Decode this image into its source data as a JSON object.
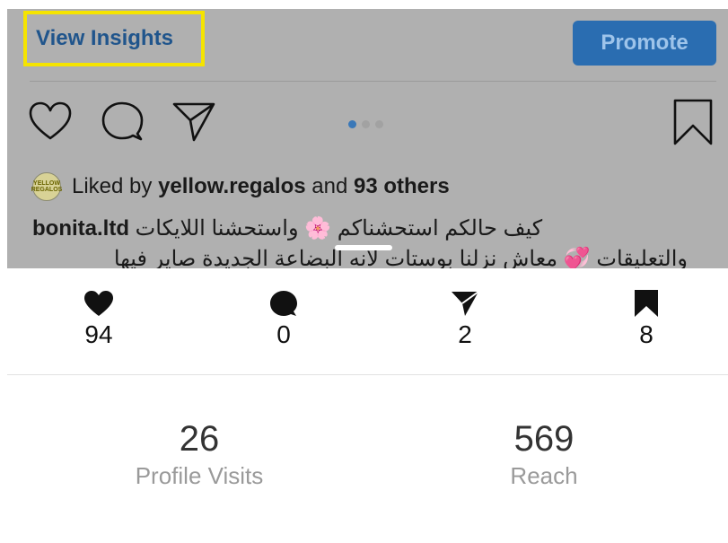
{
  "header": {
    "view_insights_label": "View Insights",
    "promote_label": "Promote"
  },
  "post": {
    "carousel": {
      "dot_count": 3,
      "active_index": 0
    },
    "likes": {
      "prefix": "Liked by",
      "liker": "yellow.regalos",
      "connector": "and",
      "others": "93 others",
      "avatar_text": "YELLOW REGALOS"
    },
    "caption": {
      "username": "bonita.ltd",
      "line1_text": "كيف حالكم استحشناكم 🌸 واستحشنا اللايكات",
      "line2_text": "والتعليقات 💞 معاش نزلنا بوستات لانه البضاعة الجديدة صاير فيها"
    }
  },
  "stats": [
    {
      "name": "likes",
      "icon": "heart-icon",
      "value": "94"
    },
    {
      "name": "comments",
      "icon": "comment-icon",
      "value": "0"
    },
    {
      "name": "shares",
      "icon": "send-icon",
      "value": "2"
    },
    {
      "name": "saves",
      "icon": "bookmark-icon",
      "value": "8"
    }
  ],
  "metrics": [
    {
      "name": "profile-visits",
      "value": "26",
      "label": "Profile Visits"
    },
    {
      "name": "reach",
      "value": "569",
      "label": "Reach"
    }
  ],
  "colors": {
    "highlight_border": "#f5e400",
    "link_blue": "#20558c",
    "promote_blue": "#2a6db1",
    "carousel_active": "#3a78b8"
  }
}
